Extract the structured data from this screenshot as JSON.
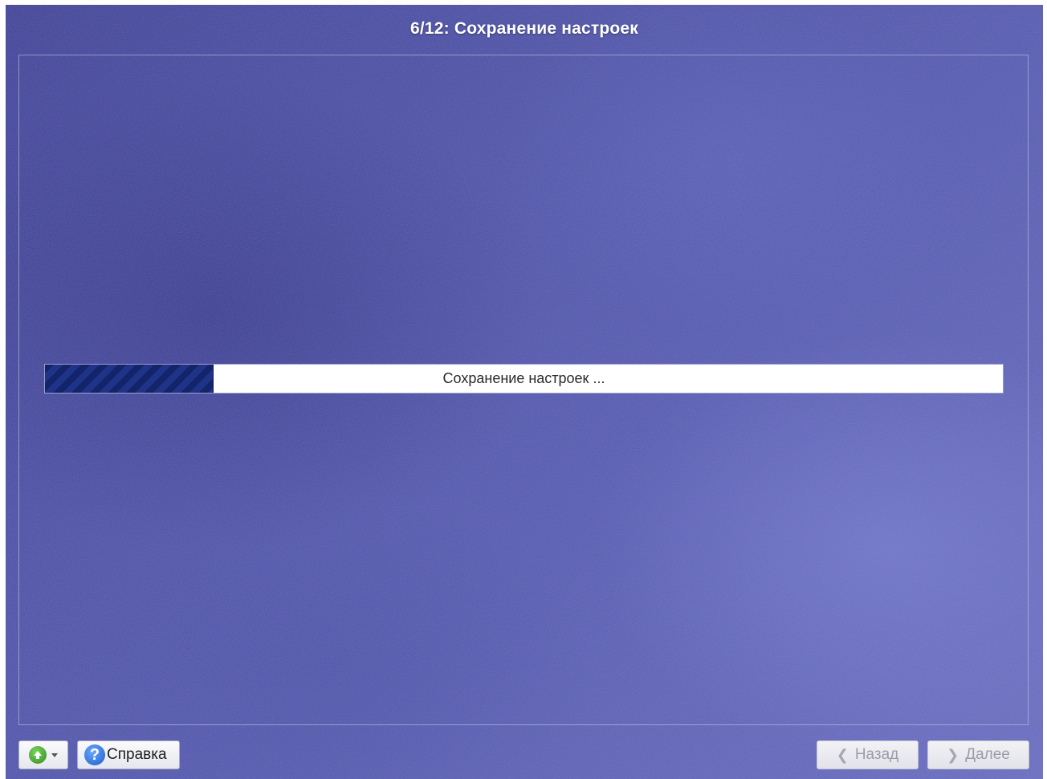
{
  "header": {
    "title": "6/12: Сохранение настроек"
  },
  "progress": {
    "label": "Сохранение настроек ...",
    "fraction": 0.175
  },
  "footer": {
    "up_button": {
      "icon": "up-arrow-icon"
    },
    "help_button": {
      "label": "Справка",
      "icon": "help-icon"
    },
    "back_button": {
      "label": "Назад",
      "icon": "chevron-left-icon",
      "enabled": false
    },
    "next_button": {
      "label": "Далее",
      "icon": "chevron-right-icon",
      "enabled": false
    }
  },
  "colors": {
    "background": "#4a4ea3",
    "progress_fill": "#14246a",
    "title_text": "#ffffff"
  }
}
